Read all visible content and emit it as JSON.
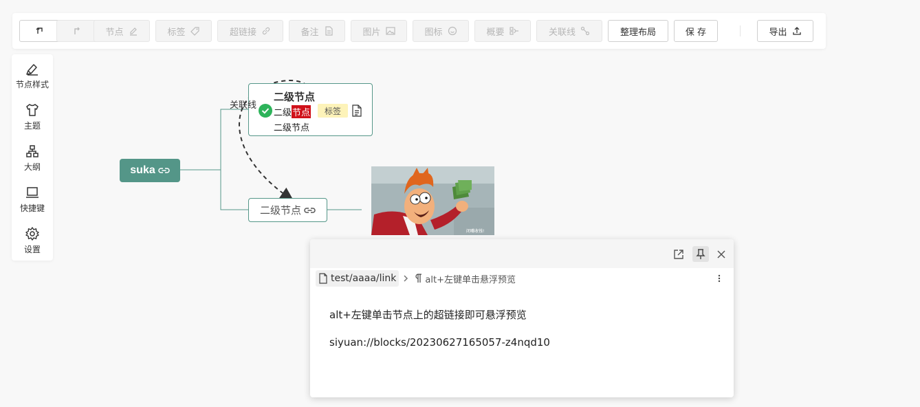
{
  "toolbar": {
    "node": "节点",
    "tag": "标签",
    "hyperlink": "超链接",
    "note": "备注",
    "image": "图片",
    "icon": "图标",
    "summary": "概要",
    "association": "关联线",
    "arrange_layout": "整理布局",
    "save": "保 存",
    "export": "导出"
  },
  "sidebar": {
    "items": [
      {
        "label": "节点样式",
        "icon": "brush-icon"
      },
      {
        "label": "主题",
        "icon": "shirt-icon"
      },
      {
        "label": "大纲",
        "icon": "outline-icon"
      },
      {
        "label": "快捷键",
        "icon": "keyboard-icon"
      },
      {
        "label": "设置",
        "icon": "gear-icon"
      }
    ]
  },
  "mindmap": {
    "root": {
      "text": "suka",
      "color": "#549688"
    },
    "node1": {
      "title": "二级节点",
      "row_prefix": "二级",
      "row_highlight": "节点",
      "tag": "标签",
      "sub": "二级节点"
    },
    "node2": {
      "text": "二级节点"
    },
    "association_label": "关联线",
    "image_caption": "闭嘴收钱!"
  },
  "popover": {
    "breadcrumb_doc": "test/aaaa/link",
    "breadcrumb_block": "alt+左键单击悬浮预览",
    "line1": "alt+左键单击节点上的超链接即可悬浮预览",
    "line2": "siyuan://blocks/20230627165057-z4nqd10"
  }
}
